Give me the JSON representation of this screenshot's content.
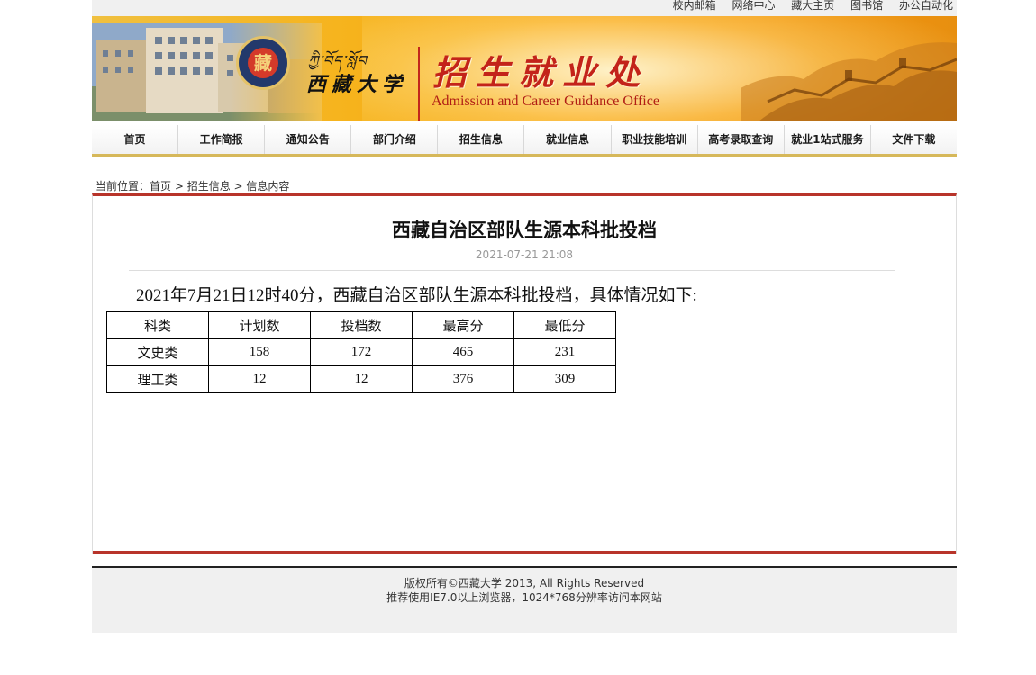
{
  "topbar": {
    "links": [
      "校内邮箱",
      "网络中心",
      "藏大主页",
      "图书馆",
      "办公自动化"
    ]
  },
  "banner": {
    "emblem_char": "藏",
    "school_name_tibetan": "ཀྱི་བོད་སློབ",
    "school_name_cn": "西藏大学",
    "office_name_cn": "招生就业处",
    "office_name_en": "Admission and Career Guidance Office"
  },
  "nav": {
    "items": [
      "首页",
      "工作简报",
      "通知公告",
      "部门介绍",
      "招生信息",
      "就业信息",
      "职业技能培训",
      "高考录取查询",
      "就业1站式服务",
      "文件下载"
    ]
  },
  "breadcrumb": {
    "prefix": "当前位置：",
    "home": "首页",
    "sep1": " > ",
    "section": "招生信息",
    "sep2": " > ",
    "current": "信息内容"
  },
  "article": {
    "title": "西藏自治区部队生源本科批投档",
    "date": "2021-07-21 21:08",
    "intro": "2021年7月21日12时40分，西藏自治区部队生源本科批投档，具体情况如下:",
    "table": {
      "headers": [
        "科类",
        "计划数",
        "投档数",
        "最高分",
        "最低分"
      ],
      "rows": [
        [
          "文史类",
          "158",
          "172",
          "465",
          "231"
        ],
        [
          "理工类",
          "12",
          "12",
          "376",
          "309"
        ]
      ]
    }
  },
  "footer": {
    "copyright": "版权所有©西藏大学 2013, All Rights Reserved",
    "browser_note": "推荐使用IE7.0以上浏览器，1024*768分辨率访问本网站"
  },
  "colors": {
    "accent_red": "#b8342a",
    "banner_orange": "#f6b31c",
    "nav_underline": "#d6b85a"
  }
}
